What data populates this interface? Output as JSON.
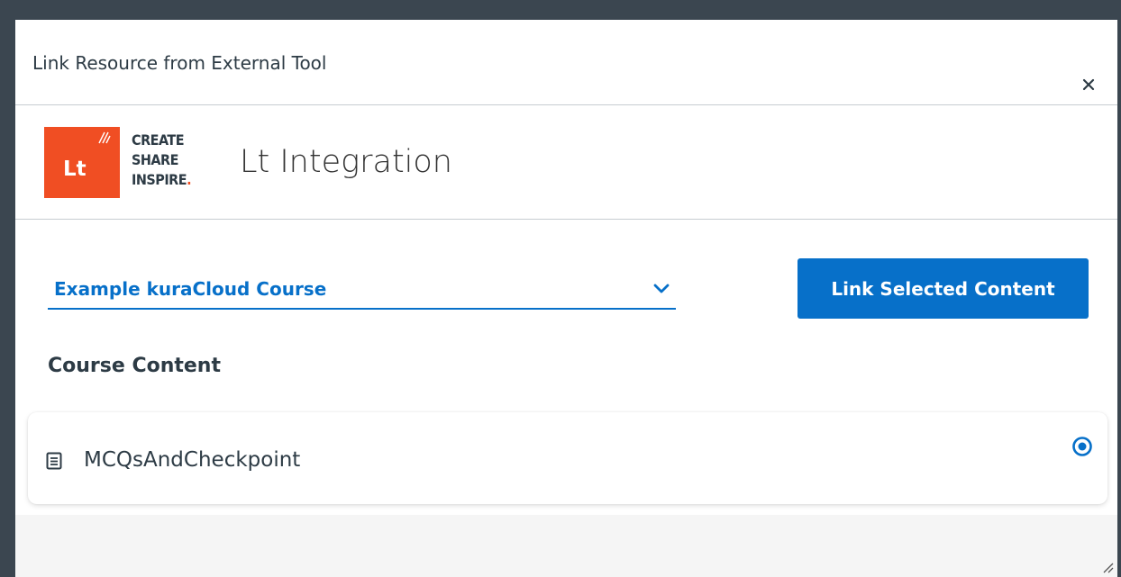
{
  "dialog": {
    "title": "Link Resource from External Tool",
    "close_icon": "close-icon"
  },
  "tool": {
    "logo_text": "Lt",
    "tagline": [
      "CREATE",
      "SHARE",
      "INSPIRE"
    ],
    "tagline_dot": ".",
    "name": "Lt Integration",
    "brand_color": "#f04e23"
  },
  "course_select": {
    "value": "Example kuraCloud Course",
    "icon": "chevron-down-icon"
  },
  "link_button": {
    "label": "Link Selected Content",
    "color": "#0770c9"
  },
  "course_content": {
    "title": "Course Content",
    "items": [
      {
        "label": "MCQsAndCheckpoint",
        "icon": "document-icon",
        "selected": true
      }
    ]
  }
}
